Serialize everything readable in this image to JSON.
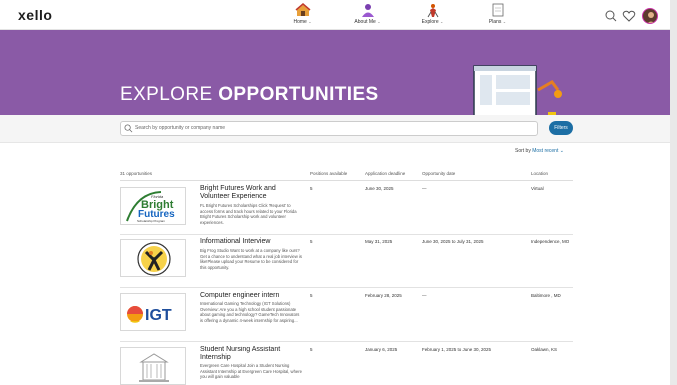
{
  "brand": {
    "logo": "xello"
  },
  "nav": {
    "items": [
      {
        "label": "Home",
        "icon": "home-icon"
      },
      {
        "label": "About Me",
        "icon": "person-icon"
      },
      {
        "label": "Explore",
        "icon": "explore-icon"
      },
      {
        "label": "Plans",
        "icon": "plans-icon"
      }
    ],
    "caret": "⌄"
  },
  "hero": {
    "title_light": "EXPLORE ",
    "title_bold": "OPPORTUNITIES",
    "color": "#8a5aa6"
  },
  "search": {
    "placeholder": "Search by opportunity or company name",
    "filters_label": "Filters"
  },
  "sort": {
    "label": "Sort by",
    "value": "Most recent ⌄"
  },
  "table": {
    "count": "31 opportunities",
    "headers": [
      "Positions available",
      "Application deadline",
      "Opportunity date",
      "Location"
    ],
    "rows": [
      {
        "logo": "bright-futures",
        "title": "Bright Futures Work and Volunteer Experience",
        "description": "FL Bright Futures Scholarships Click 'Request' to access forms and track hours related to your Florida Bright Futures Scholarship work and volunteer experiences.",
        "positions": "5",
        "deadline": "June 30, 2025",
        "date": "—",
        "location": "Virtual"
      },
      {
        "logo": "bigfrog",
        "title": "Informational Interview",
        "description": "Big Frog Studio Want to work at a company like ours?Get a chance to understand what a real job interview is like!Please upload your Resume to be considered for this opportunity.",
        "positions": "5",
        "deadline": "May 31, 2025",
        "date": "June 30, 2025 to July 31, 2025",
        "location": "Independence, MO"
      },
      {
        "logo": "igt",
        "title": "Computer engineer intern",
        "description": "International Gaming Technology (IGT Solutions) Overview: Are you a high school student passionate about gaming and technology? GameTech Innovators is offering a dynamic 4-week internship for aspiring...",
        "positions": "5",
        "deadline": "February 28, 2025",
        "date": "—",
        "location": "Baltimore , MD"
      },
      {
        "logo": "hospital",
        "title": "Student Nursing Assistant Internship",
        "description": "Evergreen Care Hospital Join a Student Nursing Assistant Internship at Evergreen Care Hospital, where you will gain valuable",
        "positions": "5",
        "deadline": "January 6, 2025",
        "date": "February 1, 2025 to June 30, 2025",
        "location": "Oaklawn, KS"
      }
    ]
  },
  "logos": {
    "bf_line1": "Florida",
    "bf_line2": "Bright",
    "bf_line3": "Futures",
    "bf_line4": "Scholarship Program",
    "igt": "IGT"
  }
}
